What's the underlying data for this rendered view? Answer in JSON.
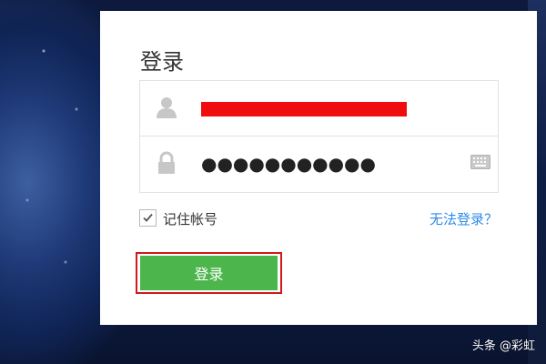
{
  "login": {
    "title": "登录",
    "username": {
      "icon": "user-icon",
      "value_redacted": true
    },
    "password": {
      "icon": "lock-icon",
      "value": "●●●●●●●●●●●",
      "keyboard_icon": "keyboard-icon"
    },
    "remember": {
      "label": "记住帐号",
      "checked": true
    },
    "cant_login_link": "无法登录？",
    "submit_label": "登录"
  },
  "colors": {
    "submit_button": "#4cb64c",
    "link": "#2d8ce8",
    "highlight_outline": "#d21919",
    "redaction": "#ef0d0d"
  },
  "watermark": "头条 @彩虹"
}
